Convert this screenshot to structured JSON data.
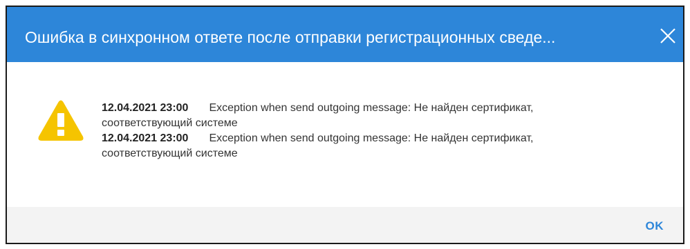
{
  "dialog": {
    "title": "Ошибка в синхронном ответе после отправки регистрационных сведе...",
    "close_icon": "close-icon",
    "warning_icon": "warning-triangle-icon",
    "accent_color": "#2d86d9",
    "warning_color": "#f5c400",
    "messages": [
      {
        "date": "12.04.2021 23:00",
        "text": "Exception when send outgoing message: Не найден сертификат, соответствующий системе"
      },
      {
        "date": "12.04.2021 23:00",
        "text": "Exception when send outgoing message: Не найден сертификат, соответствующий системе"
      }
    ],
    "ok_label": "OK"
  }
}
